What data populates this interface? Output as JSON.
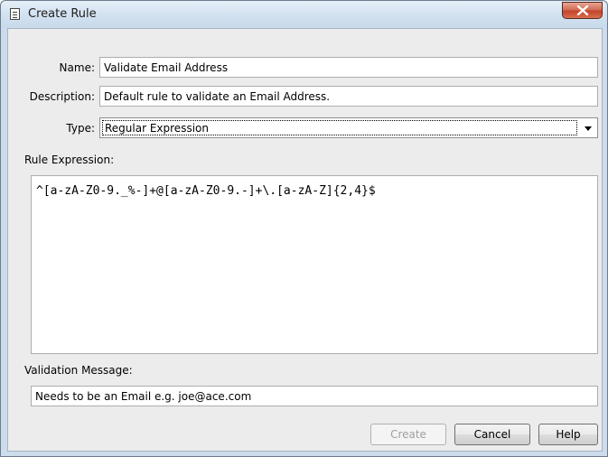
{
  "window": {
    "title": "Create Rule",
    "icon": "document-icon",
    "close_icon": "close-icon"
  },
  "form": {
    "name_label": "Name:",
    "name_value": "Validate Email Address",
    "description_label": "Description:",
    "description_value": "Default rule to validate an Email Address.",
    "type_label": "Type:",
    "type_value": "Regular Expression",
    "rule_expression_label": "Rule Expression:",
    "rule_expression_value": "^[a-zA-Z0-9._%-]+@[a-zA-Z0-9.-]+\\.[a-zA-Z]{2,4}$",
    "validation_message_label": "Validation Message:",
    "validation_message_value": "Needs to be an Email e.g. joe@ace.com"
  },
  "buttons": {
    "create": "Create",
    "create_enabled": false,
    "cancel": "Cancel",
    "help": "Help"
  }
}
